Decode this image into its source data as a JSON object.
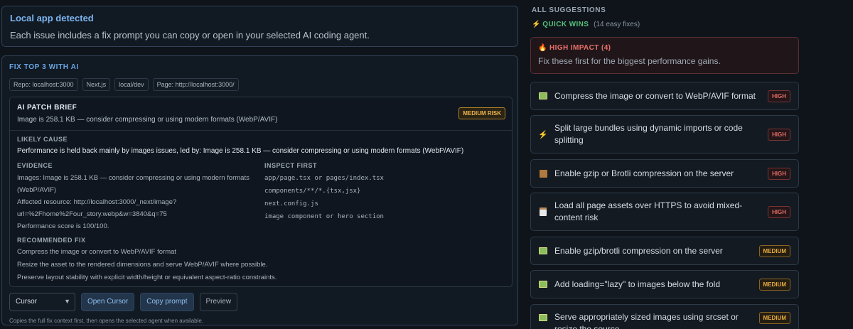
{
  "detected": {
    "title": "Local app detected",
    "description": "Each issue includes a fix prompt you can copy or open in your selected AI coding agent."
  },
  "fix": {
    "heading": "FIX TOP 3 WITH AI",
    "chips": [
      "Repo: localhost:3000",
      "Next.js",
      "local/dev",
      "Page: http://localhost:3000/"
    ],
    "brief": {
      "title": "AI PATCH BRIEF",
      "subtitle": "Image is 258.1 KB — consider compressing or using modern formats (WebP/AVIF)",
      "risk": "MEDIUM RISK",
      "likely_cause_label": "LIKELY CAUSE",
      "likely_cause": "Performance is held back mainly by images issues, led by: Image is 258.1 KB — consider compressing or using modern formats (WebP/AVIF)",
      "evidence_label": "EVIDENCE",
      "evidence_lines": [
        "Images: Image is 258.1 KB — consider compressing or using modern formats",
        "(WebP/AVIF)",
        "Affected resource: http://localhost:3000/_next/image?",
        "url=%2Fhome%2Four_story.webp&w=3840&q=75",
        "Performance score is 100/100."
      ],
      "inspect_label": "INSPECT FIRST",
      "inspect_items": [
        "app/page.tsx or pages/index.tsx",
        "components/**/*.{tsx,jsx}",
        "next.config.js",
        "image component or hero section"
      ],
      "recommended_label": "RECOMMENDED FIX",
      "recommended_items": [
        "Compress the image or convert to WebP/AVIF format",
        "Resize the asset to the rendered dimensions and serve WebP/AVIF where possible.",
        "Preserve layout stability with explicit width/height or equivalent aspect-ratio constraints."
      ]
    },
    "agent_select": "Cursor",
    "open_button": "Open Cursor",
    "copy_button": "Copy prompt",
    "preview_button": "Preview",
    "footnote": "Copies the full fix context first, then opens the selected agent when available."
  },
  "suggestions": {
    "heading": "ALL SUGGESTIONS",
    "quick_wins": "QUICK WINS",
    "quick_wins_count": "(14 easy fixes)",
    "high_impact": {
      "title": "HIGH IMPACT (4)",
      "description": "Fix these first for the biggest performance gains."
    },
    "items": [
      {
        "text": "Compress the image or convert to WebP/AVIF format",
        "badge": "HIGH",
        "icon": "image-icon"
      },
      {
        "text": "Split large bundles using dynamic imports or code splitting",
        "badge": "HIGH",
        "icon": "lightning-icon"
      },
      {
        "text": "Enable gzip or Brotli compression on the server",
        "badge": "HIGH",
        "icon": "package-icon"
      },
      {
        "text": "Load all page assets over HTTPS to avoid mixed-content risk",
        "badge": "HIGH",
        "icon": "clipboard-icon"
      },
      {
        "text": "Enable gzip/brotli compression on the server",
        "badge": "MEDIUM",
        "icon": "image-icon"
      },
      {
        "text": "Add loading=\"lazy\" to images below the fold",
        "badge": "MEDIUM",
        "icon": "image-icon"
      },
      {
        "text": "Serve appropriately sized images using srcset or resize the source",
        "badge": "MEDIUM",
        "icon": "image-icon"
      }
    ]
  }
}
